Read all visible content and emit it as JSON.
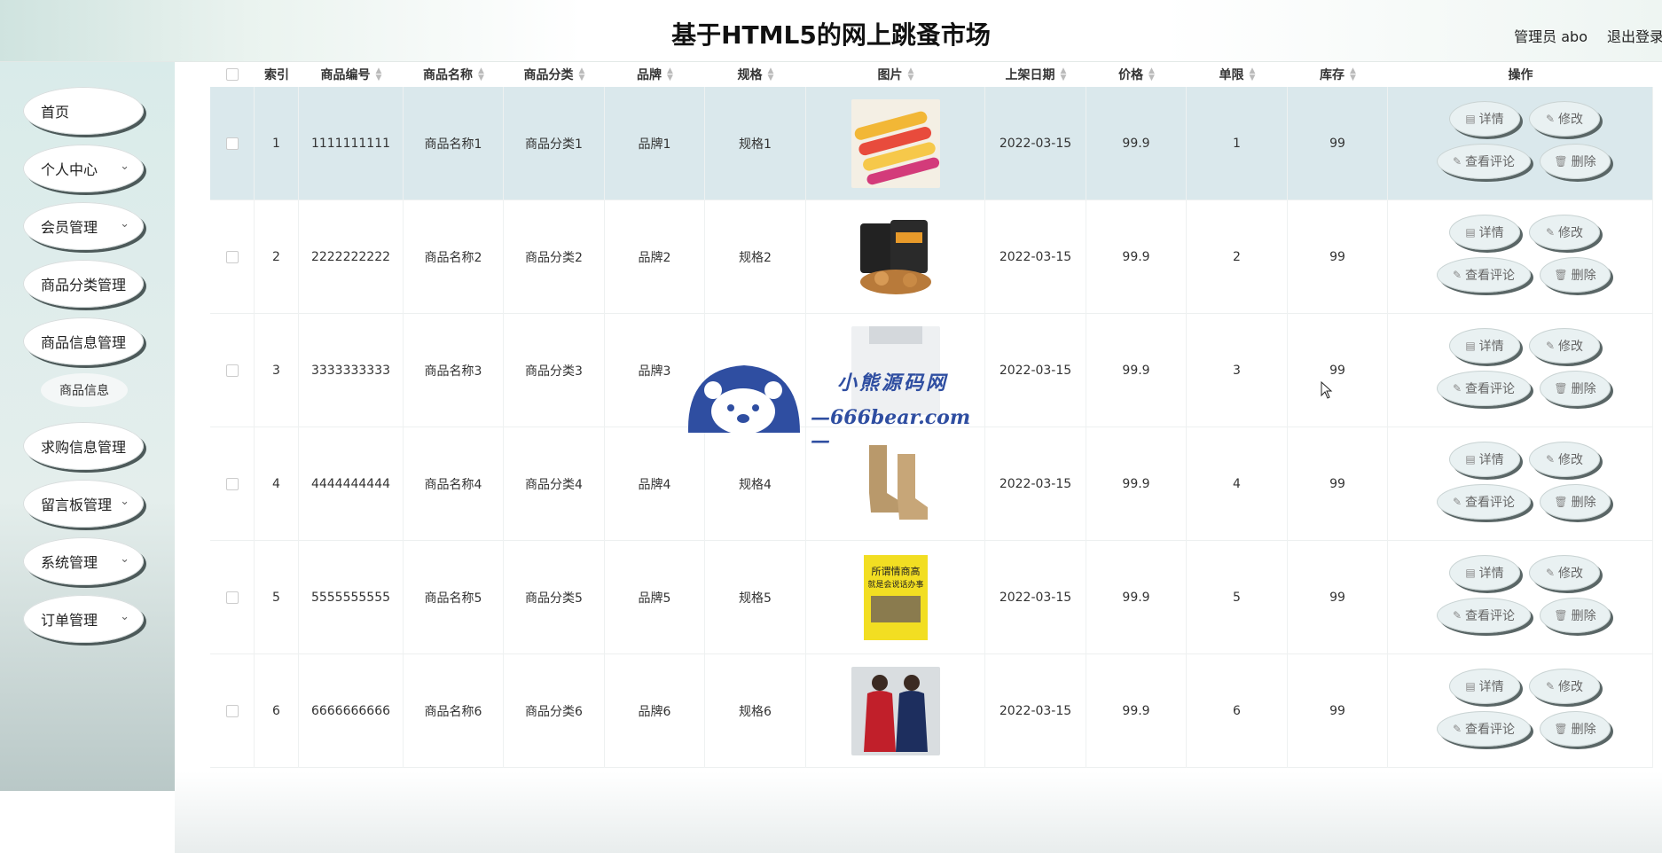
{
  "header": {
    "title": "基于HTML5的网上跳蚤市场",
    "user": "管理员 abo",
    "logout": "退出登录"
  },
  "sidebar": {
    "items": [
      {
        "label": "首页",
        "arrow": ""
      },
      {
        "label": "个人中心",
        "arrow": "⌄"
      },
      {
        "label": "会员管理",
        "arrow": "⌄"
      },
      {
        "label": "商品分类管理",
        "arrow": ""
      },
      {
        "label": "商品信息管理",
        "arrow": ""
      },
      {
        "label": "求购信息管理",
        "arrow": ""
      },
      {
        "label": "留言板管理",
        "arrow": "⌄"
      },
      {
        "label": "系统管理",
        "arrow": "⌄"
      },
      {
        "label": "订单管理",
        "arrow": "⌄"
      }
    ],
    "sub_item": "商品信息"
  },
  "table": {
    "headers": {
      "index": "索引",
      "code": "商品编号",
      "name": "商品名称",
      "category": "商品分类",
      "brand": "品牌",
      "spec": "规格",
      "image": "图片",
      "date": "上架日期",
      "price": "价格",
      "limit": "单限",
      "stock": "库存",
      "actions": "操作"
    },
    "rows": [
      {
        "index": "1",
        "code": "1111111111",
        "name": "商品名称1",
        "category": "商品分类1",
        "brand": "品牌1",
        "spec": "规格1",
        "date": "2022-03-15",
        "price": "99.9",
        "limit": "1",
        "stock": "99"
      },
      {
        "index": "2",
        "code": "2222222222",
        "name": "商品名称2",
        "category": "商品分类2",
        "brand": "品牌2",
        "spec": "规格2",
        "date": "2022-03-15",
        "price": "99.9",
        "limit": "2",
        "stock": "99"
      },
      {
        "index": "3",
        "code": "3333333333",
        "name": "商品名称3",
        "category": "商品分类3",
        "brand": "品牌3",
        "spec": "",
        "date": "2022-03-15",
        "price": "99.9",
        "limit": "3",
        "stock": "99"
      },
      {
        "index": "4",
        "code": "4444444444",
        "name": "商品名称4",
        "category": "商品分类4",
        "brand": "品牌4",
        "spec": "规格4",
        "date": "2022-03-15",
        "price": "99.9",
        "limit": "4",
        "stock": "99"
      },
      {
        "index": "5",
        "code": "5555555555",
        "name": "商品名称5",
        "category": "商品分类5",
        "brand": "品牌5",
        "spec": "规格5",
        "date": "2022-03-15",
        "price": "99.9",
        "limit": "5",
        "stock": "99"
      },
      {
        "index": "6",
        "code": "6666666666",
        "name": "商品名称6",
        "category": "商品分类6",
        "brand": "品牌6",
        "spec": "规格6",
        "date": "2022-03-15",
        "price": "99.9",
        "limit": "6",
        "stock": "99"
      }
    ],
    "actions": {
      "detail": "详情",
      "edit": "修改",
      "comments": "查看评论",
      "delete": "删除"
    }
  },
  "watermark": {
    "line1": "小熊源码网",
    "line2": "—666bear.com—"
  }
}
